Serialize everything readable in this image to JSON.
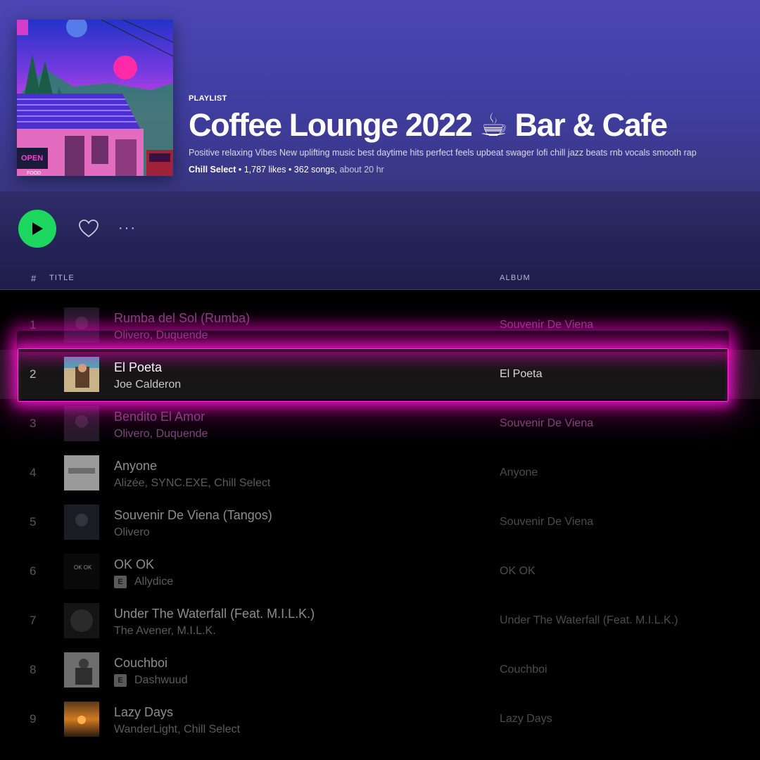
{
  "playlist": {
    "type_label": "PLAYLIST",
    "title": "Coffee Lounge 2022 ☕ Bar & Cafe",
    "description": "Positive relaxing Vibes New uplifting music best daytime hits perfect feels upbeat swager lofi chill jazz beats rnb vocals smooth rap",
    "owner": "Chill Select",
    "likes_text": " • 1,787 likes • ",
    "songs_text": "362 songs,",
    "duration_text": " about 20 hr",
    "cover_sign_open": "OPEN",
    "cover_sign_food": "FOOD"
  },
  "actions": {
    "play_icon": "play-icon",
    "like_icon": "heart-icon",
    "more_label": "···"
  },
  "columns": {
    "number": "#",
    "title": "TITLE",
    "album": "ALBUM"
  },
  "colors": {
    "accent_green": "#1ed760",
    "highlight_pink": "#ff33d6",
    "header_purple": "#4c46b4"
  },
  "tracks": [
    {
      "number": "1",
      "title": "Rumba del Sol (Rumba)",
      "artists": "Olivero, Duquende",
      "album": "Souvenir De Viena",
      "explicit": false
    },
    {
      "number": "2",
      "title": "El Poeta",
      "artists": "Joe Calderon",
      "album": "El Poeta",
      "explicit": false
    },
    {
      "number": "3",
      "title": "Bendito El Amor",
      "artists": "Olivero, Duquende",
      "album": "Souvenir De Viena",
      "explicit": false
    },
    {
      "number": "4",
      "title": "Anyone",
      "artists": "Alizée, SYNC.EXE, Chill Select",
      "album": "Anyone",
      "explicit": false
    },
    {
      "number": "5",
      "title": "Souvenir De Viena (Tangos)",
      "artists": "Olivero",
      "album": "Souvenir De Viena",
      "explicit": false
    },
    {
      "number": "6",
      "title": "OK OK",
      "artists": "Allydice",
      "album": "OK OK",
      "explicit": true,
      "explicit_label": "E"
    },
    {
      "number": "7",
      "title": "Under The Waterfall (Feat. M.I.L.K.)",
      "artists": "The Avener, M.I.L.K.",
      "album": "Under The Waterfall (Feat. M.I.L.K.)",
      "explicit": false
    },
    {
      "number": "8",
      "title": "Couchboi",
      "artists": "Dashwuud",
      "album": "Couchboi",
      "explicit": true,
      "explicit_label": "E"
    },
    {
      "number": "9",
      "title": "Lazy Days",
      "artists": "WanderLight, Chill Select",
      "album": "Lazy Days",
      "explicit": false
    }
  ],
  "highlighted_track": "2"
}
